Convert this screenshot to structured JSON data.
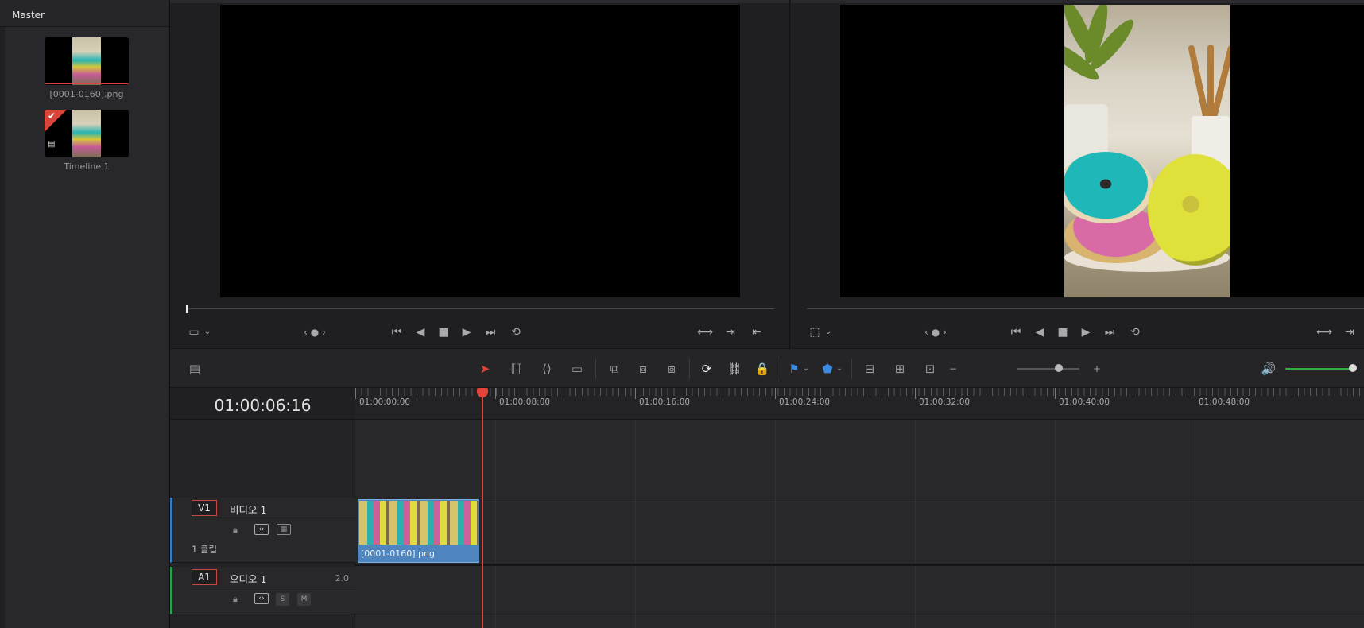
{
  "media_pool": {
    "title": "Master",
    "items": [
      {
        "label": "[0001-0160].png",
        "type": "clip"
      },
      {
        "label": "Timeline 1",
        "type": "timeline"
      }
    ]
  },
  "source_viewer": {
    "controls": [
      "clip-view-icon",
      "chevron-down-icon",
      "nav-dots",
      "jump-start-icon",
      "play-reverse-icon",
      "stop-icon",
      "play-icon",
      "jump-end-icon",
      "loop-icon",
      "match-frame-icon",
      "next-frame-icon",
      "prev-frame-icon"
    ]
  },
  "timeline_viewer": {
    "controls": [
      "crop-icon",
      "chevron-down-icon",
      "nav-dots",
      "jump-start-icon",
      "play-reverse-icon",
      "stop-icon",
      "play-icon",
      "jump-end-icon",
      "loop-icon",
      "match-frame-icon",
      "next-frame-icon"
    ]
  },
  "toolbar": {
    "zoom_minus": "−",
    "zoom_plus": "+",
    "volume_level": 0.95,
    "accent_color": "#2fae3c"
  },
  "timecode": "01:00:06:16",
  "ruler": [
    "01:00:00:00",
    "01:00:08:00",
    "01:00:16:00",
    "01:00:24:00",
    "01:00:32:00",
    "01:00:40:00",
    "01:00:48:00"
  ],
  "tracks": {
    "video": {
      "id": "V1",
      "name": "비디오 1",
      "clip_count": "1 클립"
    },
    "audio": {
      "id": "A1",
      "name": "오디오 1",
      "channels": "2.0",
      "solo": "S",
      "mute": "M"
    }
  },
  "clip": {
    "label": "[0001-0160].png"
  },
  "colors": {
    "playhead": "#e2463b",
    "video_track": "#3a7ac0",
    "audio_track": "#2e9e4f",
    "clip": "#4f86bf"
  }
}
